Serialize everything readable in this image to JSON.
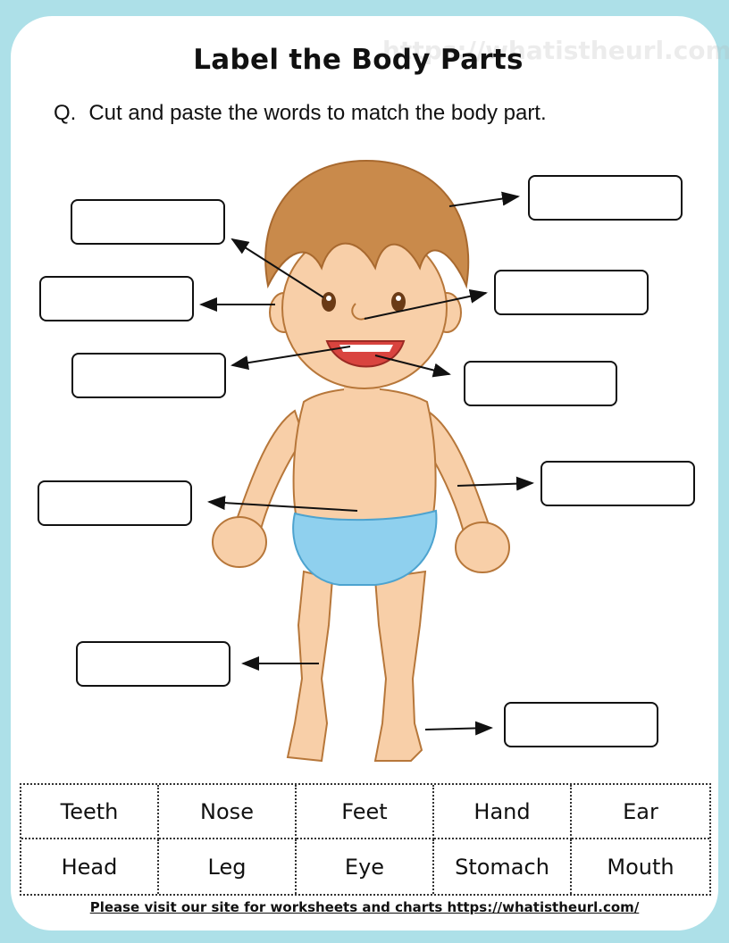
{
  "worksheet": {
    "title": "Label the Body Parts",
    "watermark": "https://whatistheurl.com",
    "question_prefix": "Q.",
    "question_text": "Cut and paste the words to match the body part.",
    "label_boxes_count": 10,
    "word_bank": [
      [
        "Teeth",
        "Nose",
        "Feet",
        "Hand",
        "Ear"
      ],
      [
        "Head",
        "Leg",
        "Eye",
        "Stomach",
        "Mouth"
      ]
    ],
    "footer": "Please visit our site for worksheets and charts https://whatistheurl.com/"
  },
  "colors": {
    "background": "#ade0e8",
    "sheet": "#ffffff",
    "skin": "#f8cfa8",
    "skin_outline": "#b7773a",
    "hair": "#c98a4b",
    "underwear": "#8fd0ee",
    "mouth": "#d9443f"
  }
}
